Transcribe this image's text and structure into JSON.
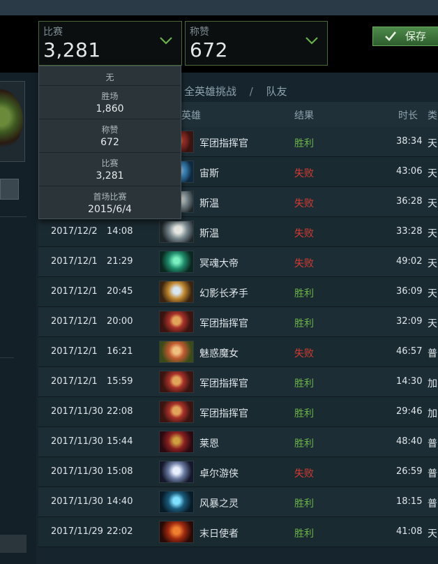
{
  "filters": [
    {
      "label": "比赛",
      "value": "3,281"
    },
    {
      "label": "称赞",
      "value": "672"
    }
  ],
  "save_button": {
    "label": "保存"
  },
  "tabs": {
    "tab1": "全英雄挑战",
    "separator": "/",
    "tab2": "队友"
  },
  "table": {
    "headers": {
      "hero": "英雄",
      "result": "结果",
      "duration": "时长",
      "type": "类"
    },
    "rows": [
      {
        "date": "",
        "time": "",
        "hero": "军团指挥官",
        "result": "胜利",
        "win": true,
        "duration": "38:34",
        "type": "天",
        "portrait": "legion-commander"
      },
      {
        "date": "",
        "time": "",
        "hero": "宙斯",
        "result": "失败",
        "win": false,
        "duration": "43:06",
        "type": "天",
        "portrait": "zeus"
      },
      {
        "date": "",
        "time": "",
        "hero": "斯温",
        "result": "失败",
        "win": false,
        "duration": "36:28",
        "type": "天",
        "portrait": "sven"
      },
      {
        "date": "2017/12/2",
        "time": "14:08",
        "hero": "斯温",
        "result": "失败",
        "win": false,
        "duration": "33:28",
        "type": "天",
        "portrait": "sven"
      },
      {
        "date": "2017/12/1",
        "time": "21:29",
        "hero": "冥魂大帝",
        "result": "失败",
        "win": false,
        "duration": "49:02",
        "type": "天",
        "portrait": "wraith-king"
      },
      {
        "date": "2017/12/1",
        "time": "20:45",
        "hero": "幻影长矛手",
        "result": "胜利",
        "win": true,
        "duration": "36:09",
        "type": "天",
        "portrait": "phantom-lancer"
      },
      {
        "date": "2017/12/1",
        "time": "20:00",
        "hero": "军团指挥官",
        "result": "胜利",
        "win": true,
        "duration": "32:09",
        "type": "天",
        "portrait": "legion-commander"
      },
      {
        "date": "2017/12/1",
        "time": "16:21",
        "hero": "魅惑魔女",
        "result": "失败",
        "win": false,
        "duration": "46:57",
        "type": "普",
        "portrait": "enchantress"
      },
      {
        "date": "2017/12/1",
        "time": "15:59",
        "hero": "军团指挥官",
        "result": "胜利",
        "win": true,
        "duration": "14:30",
        "type": "加",
        "portrait": "legion-commander"
      },
      {
        "date": "2017/11/30",
        "time": "22:08",
        "hero": "军团指挥官",
        "result": "胜利",
        "win": true,
        "duration": "29:46",
        "type": "加",
        "portrait": "legion-commander"
      },
      {
        "date": "2017/11/30",
        "time": "15:44",
        "hero": "莱恩",
        "result": "胜利",
        "win": true,
        "duration": "48:40",
        "type": "普",
        "portrait": "lion"
      },
      {
        "date": "2017/11/30",
        "time": "15:08",
        "hero": "卓尔游侠",
        "result": "失败",
        "win": false,
        "duration": "26:59",
        "type": "普",
        "portrait": "drow-ranger"
      },
      {
        "date": "2017/11/30",
        "time": "14:40",
        "hero": "风暴之灵",
        "result": "胜利",
        "win": true,
        "duration": "18:15",
        "type": "普",
        "portrait": "storm-spirit"
      },
      {
        "date": "2017/11/29",
        "time": "22:02",
        "hero": "末日使者",
        "result": "胜利",
        "win": true,
        "duration": "41:08",
        "type": "天",
        "portrait": "doom"
      }
    ]
  },
  "dropdown": {
    "none_label": "无",
    "options": [
      {
        "label": "胜场",
        "value": "1,860"
      },
      {
        "label": "称赞",
        "value": "672"
      },
      {
        "label": "比赛",
        "value": "3,281"
      },
      {
        "label": "首场比赛",
        "value": "2015/6/4"
      }
    ]
  },
  "colors": {
    "win": "#69b248",
    "lose": "#d83a32",
    "accent_border": "#4b6a3a"
  },
  "icons": {
    "chevron": "chevron-down-icon",
    "check": "check-icon"
  }
}
